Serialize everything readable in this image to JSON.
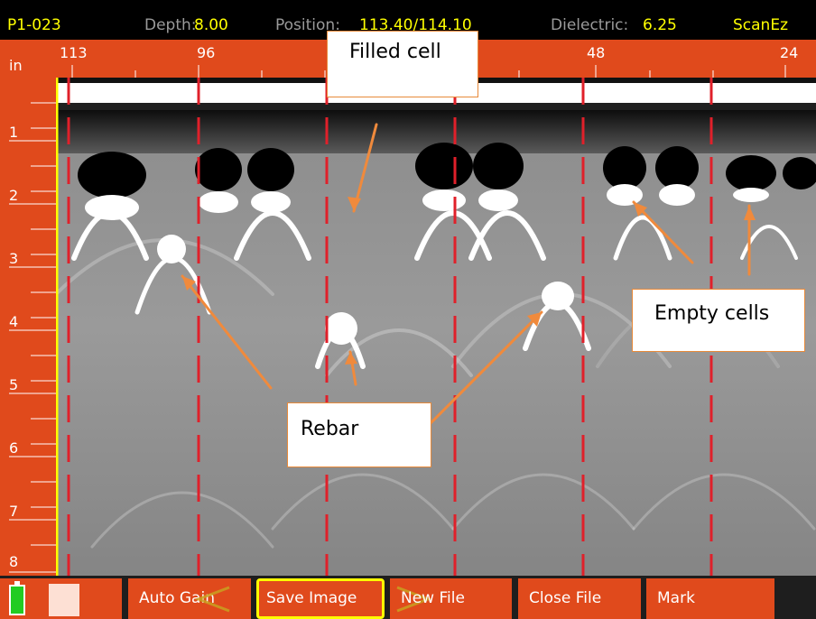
{
  "header": {
    "file_id": "P1-023",
    "depth_label": "Depth:",
    "depth_value": "8.00",
    "position_label": "Position:",
    "position_value": "113.40/114.10",
    "dielectric_label": "Dielectric:",
    "dielectric_value": "6.25",
    "mode": "ScanEz"
  },
  "horizontal_ruler": {
    "unit": "in",
    "ticks": [
      "113",
      "96",
      "48",
      "24"
    ]
  },
  "vertical_ruler": {
    "ticks": [
      "1",
      "2",
      "3",
      "4",
      "5",
      "6",
      "7",
      "8"
    ]
  },
  "annotations": {
    "filled_cell": "Filled cell",
    "empty_cells": "Empty cells",
    "rebar": "Rebar"
  },
  "toolbar": {
    "auto_gain": "Auto Gain",
    "save_image": "Save Image",
    "new_file": "New File",
    "close_file": "Close File",
    "mark": "Mark"
  },
  "icons": {
    "battery": "battery-icon",
    "storage": "storage-icon",
    "left_arrow": "chevron-left-icon",
    "right_arrow": "chevron-right-icon"
  },
  "colors": {
    "accent": "#e04a1c",
    "highlight": "#ffff00",
    "marker": "#e0202a",
    "arrow": "#f08a3c",
    "battery": "#22cc22"
  }
}
